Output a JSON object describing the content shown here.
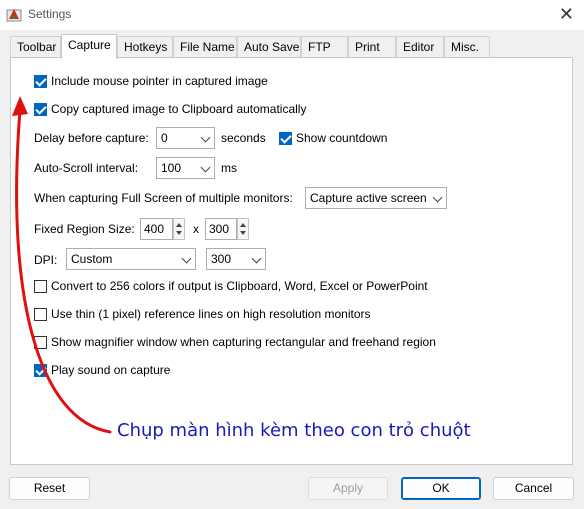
{
  "window": {
    "title": "Settings",
    "close_glyph": "✕"
  },
  "tabs": [
    {
      "label": "Toolbar"
    },
    {
      "label": "Capture"
    },
    {
      "label": "Hotkeys"
    },
    {
      "label": "File Name"
    },
    {
      "label": "Auto Save"
    },
    {
      "label": "FTP"
    },
    {
      "label": "Print"
    },
    {
      "label": "Editor"
    },
    {
      "label": "Misc."
    }
  ],
  "capture": {
    "include_pointer": {
      "label": "Include mouse pointer in captured image",
      "checked": true
    },
    "copy_clipboard": {
      "label": "Copy captured image to Clipboard automatically",
      "checked": true
    },
    "delay": {
      "label": "Delay before capture:",
      "value": "0",
      "unit": "seconds"
    },
    "show_countdown": {
      "label": "Show countdown",
      "checked": true
    },
    "autoscroll": {
      "label": "Auto-Scroll interval:",
      "value": "100",
      "unit": "ms"
    },
    "multi_monitor": {
      "label": "When capturing Full Screen of multiple monitors:",
      "value": "Capture active screen"
    },
    "fixed_region": {
      "label": "Fixed Region Size:",
      "width": "400",
      "sep": "x",
      "height": "300"
    },
    "dpi": {
      "label": "DPI:",
      "mode": "Custom",
      "value": "300"
    },
    "convert_256": {
      "label": "Convert to 256 colors if output is Clipboard, Word, Excel or PowerPoint",
      "checked": false
    },
    "thin_lines": {
      "label": "Use thin (1 pixel) reference lines on high resolution monitors",
      "checked": false
    },
    "magnifier": {
      "label": "Show magnifier window when capturing rectangular and freehand region",
      "checked": false
    },
    "play_sound": {
      "label": "Play sound on capture",
      "checked": true
    }
  },
  "annotation": {
    "text": "Chụp màn hình kèm theo con trỏ chuột",
    "color": "#1a1ab8",
    "arrow_color": "#e01010"
  },
  "buttons": {
    "reset": "Reset",
    "apply": "Apply",
    "ok": "OK",
    "cancel": "Cancel"
  }
}
